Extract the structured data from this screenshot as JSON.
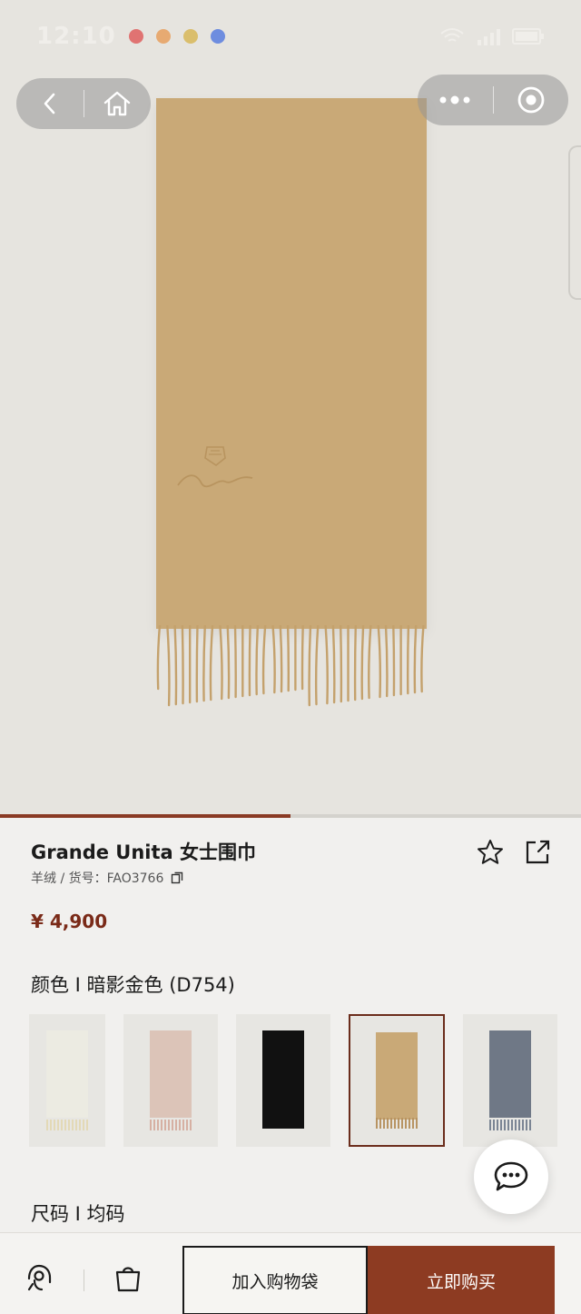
{
  "status_bar": {
    "time": "12:10"
  },
  "product": {
    "title": "Grande Unita 女士围巾",
    "subtitle": "羊绒 / 货号：FAO3766",
    "price": "¥ 4,900",
    "color_line": "颜色 I 暗影金色 (D754)",
    "size_line": "尺码 I 均码",
    "image_progress": 0.5
  },
  "swatches": [
    {
      "name": "ivory",
      "color": "#ecebe2"
    },
    {
      "name": "blush",
      "color": "#dcc4b8"
    },
    {
      "name": "black",
      "color": "#111111"
    },
    {
      "name": "camel",
      "color": "#c9a977"
    },
    {
      "name": "blue-grey",
      "color": "#6f7886"
    }
  ],
  "selected_swatch": 3,
  "actions": {
    "add_to_bag": "加入购物袋",
    "buy_now": "立即购买"
  },
  "icons": {
    "back": "chevron-left-icon",
    "home": "home-icon",
    "more": "more-dots-icon",
    "close": "target-icon",
    "star": "star-icon",
    "share": "share-icon",
    "copy": "copy-icon",
    "chat": "chat-bubble-icon",
    "service": "customer-service-icon",
    "bag": "shopping-bag-icon"
  },
  "colors": {
    "accent": "#8d3b22",
    "price": "#7a2a18",
    "scarf": "#c9a977"
  }
}
